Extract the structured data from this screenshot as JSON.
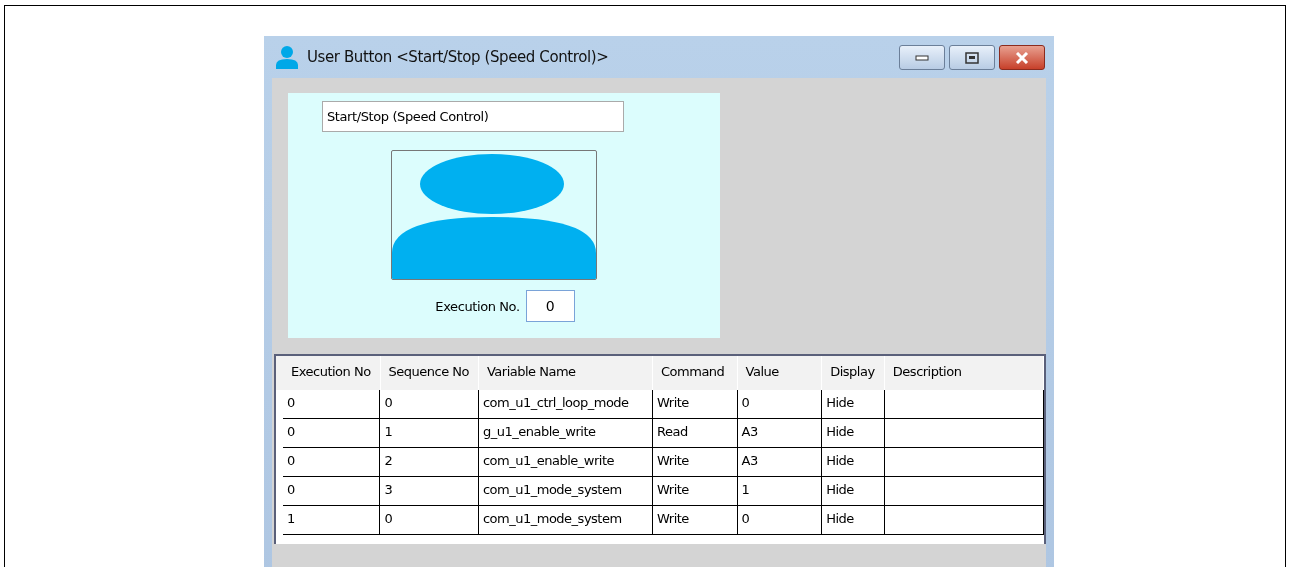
{
  "window": {
    "title": "User Button <Start/Stop (Speed Control)>"
  },
  "button_name": {
    "value": "Start/Stop (Speed Control)"
  },
  "execution": {
    "label": "Execution No.",
    "value": "0"
  },
  "table": {
    "columns": [
      "Execution No",
      "Sequence No",
      "Variable Name",
      "Command",
      "Value",
      "Display",
      "Description"
    ],
    "rows": [
      [
        "0",
        "0",
        "com_u1_ctrl_loop_mode",
        "Write",
        "0",
        "Hide",
        ""
      ],
      [
        "0",
        "1",
        "g_u1_enable_write",
        "Read",
        "A3",
        "Hide",
        ""
      ],
      [
        "0",
        "2",
        "com_u1_enable_write",
        "Write",
        "A3",
        "Hide",
        ""
      ],
      [
        "0",
        "3",
        "com_u1_mode_system",
        "Write",
        "1",
        "Hide",
        ""
      ],
      [
        "1",
        "0",
        "com_u1_mode_system",
        "Write",
        "0",
        "Hide",
        ""
      ]
    ]
  }
}
